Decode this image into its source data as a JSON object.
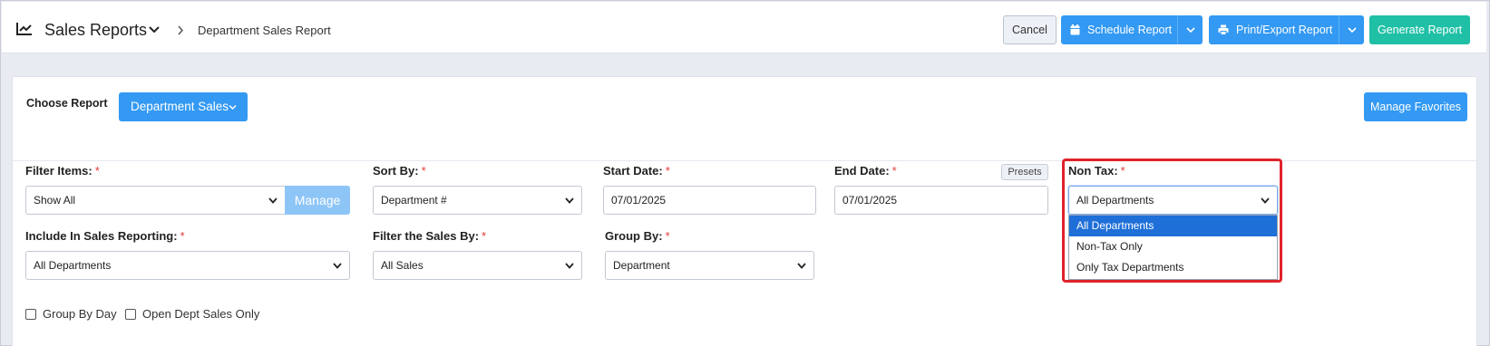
{
  "header": {
    "title": "Sales Reports",
    "breadcrumb_current": "Department Sales Report",
    "cancel_label": "Cancel",
    "schedule_label": "Schedule Report",
    "print_label": "Print/Export Report",
    "generate_label": "Generate Report"
  },
  "report": {
    "choose_label": "Choose Report",
    "selected_report": "Department Sales",
    "manage_favorites_label": "Manage Favorites"
  },
  "filters": {
    "filter_items": {
      "label": "Filter Items:",
      "value": "Show All",
      "manage_label": "Manage"
    },
    "sort_by": {
      "label": "Sort By:",
      "value": "Department #"
    },
    "start_date": {
      "label": "Start Date:",
      "value": "07/01/2025"
    },
    "end_date": {
      "label": "End Date:",
      "value": "07/01/2025",
      "presets_label": "Presets"
    },
    "non_tax": {
      "label": "Non Tax:",
      "value": "All Departments",
      "options": [
        "All Departments",
        "Non-Tax Only",
        "Only Tax Departments"
      ]
    },
    "include_in_sales": {
      "label": "Include In Sales Reporting:",
      "value": "All Departments"
    },
    "filter_sales_by": {
      "label": "Filter the Sales By:",
      "value": "All Sales"
    },
    "group_by": {
      "label": "Group By:",
      "value": "Department"
    },
    "required_mark": "*"
  },
  "options": {
    "group_by_day": "Group By Day",
    "open_dept_sales_only": "Open Dept Sales Only"
  },
  "colors": {
    "primary": "#3399f3",
    "success": "#1fc0a6",
    "highlight": "#e0232b",
    "selected_option": "#1f6fd8"
  }
}
